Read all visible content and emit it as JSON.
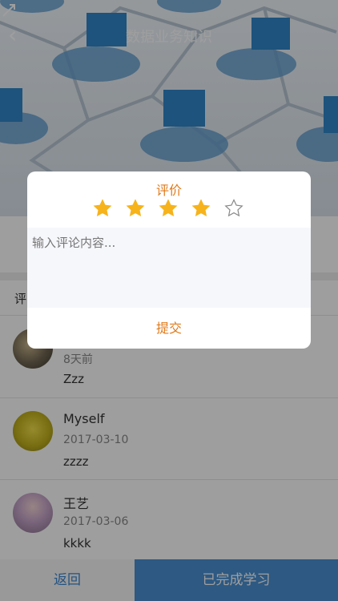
{
  "header": {
    "title": "数据业务知识"
  },
  "comments": {
    "section_title": "评",
    "items": [
      {
        "name": "",
        "date": "8天前",
        "text": "Zzz"
      },
      {
        "name": "Myself",
        "date": "2017-03-10",
        "text": "zzzz"
      },
      {
        "name": "王艺",
        "date": "2017-03-06",
        "text": "kkkk"
      }
    ]
  },
  "bottom_bar": {
    "back_label": "返回",
    "done_label": "已完成学习"
  },
  "dialog": {
    "title": "评价",
    "rating": 4,
    "rating_max": 5,
    "input_placeholder": "输入评论内容...",
    "submit_label": "提交"
  },
  "colors": {
    "accent": "#e07a1a",
    "star_fill": "#f7b31b",
    "primary": "#4a90d2"
  }
}
